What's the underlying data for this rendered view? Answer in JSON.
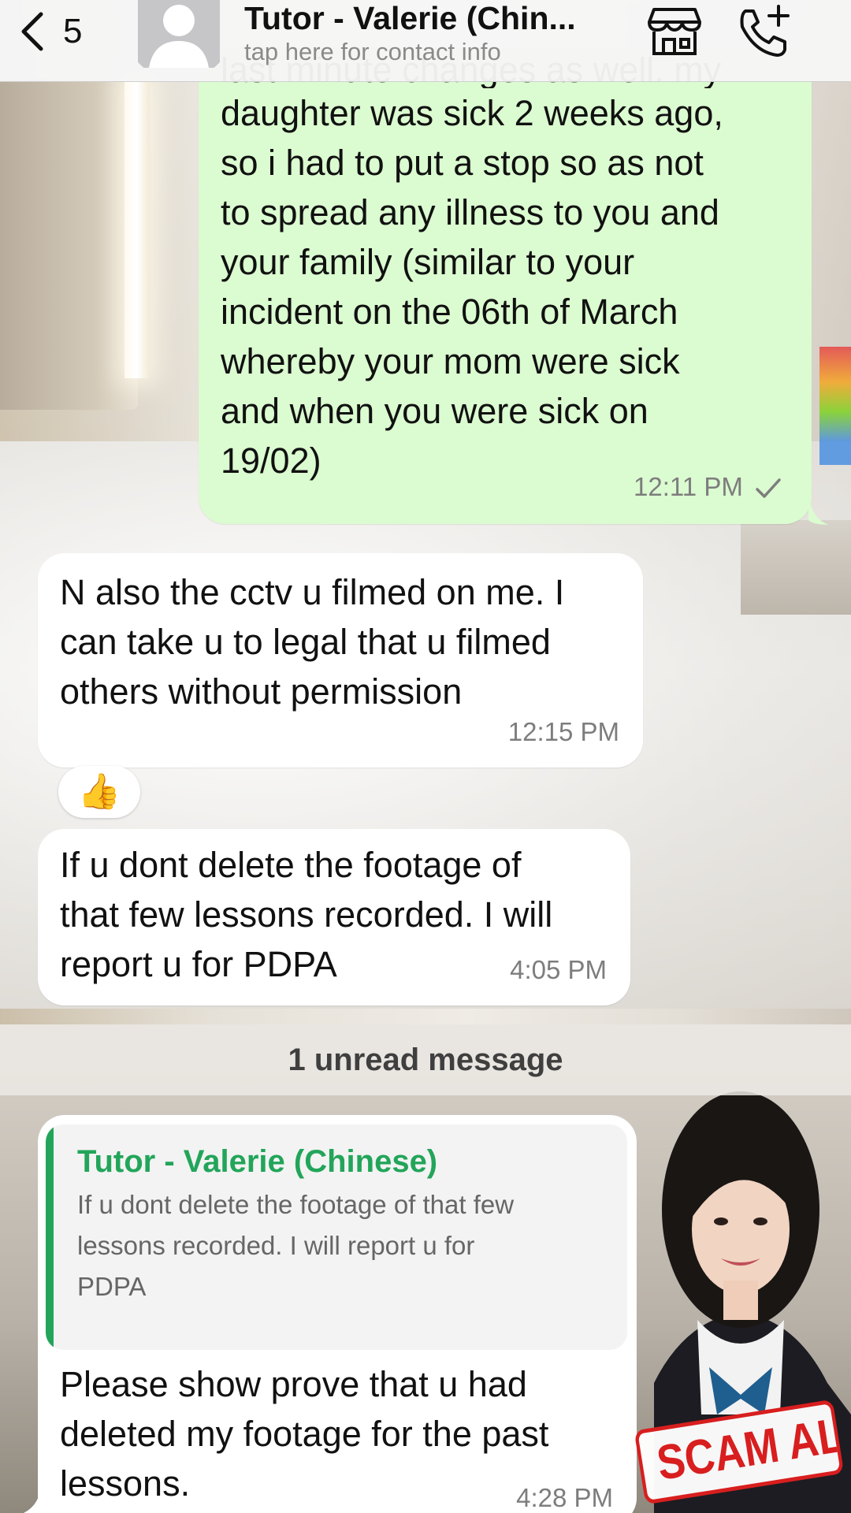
{
  "header": {
    "back_count": "5",
    "contact_name": "Tutor - Valerie (Chin...",
    "contact_subtitle": "tap here for contact info"
  },
  "messages": [
    {
      "direction": "outgoing",
      "cut_line": "last minute changes as well. my",
      "text": "daughter was sick 2 weeks ago,\nso i had to put a stop so as not\nto spread any illness to you and\nyour family (similar to your\nincident on the 06th of March\nwhereby your mom were sick\nand when you were sick on\n19/02)",
      "time": "12:11 PM",
      "status": "sent"
    },
    {
      "direction": "incoming",
      "text": "N also the cctv u filmed on me. I\ncan take u to legal that u filmed\nothers without permission",
      "time": "12:15 PM",
      "reaction": "👍"
    },
    {
      "direction": "incoming",
      "text": "If u dont delete the footage of\nthat few lessons recorded. I will\nreport u for PDPA",
      "time": "4:05 PM"
    },
    {
      "direction": "incoming",
      "quote": {
        "author": "Tutor - Valerie (Chinese)",
        "text": "If u dont delete the footage of that few\nlessons recorded. I will report u for\nPDPA"
      },
      "text": "Please show prove that u had\ndeleted my footage for the past\nlessons.",
      "time": "4:28 PM"
    }
  ],
  "unread_divider": "1 unread message",
  "stamp": "SCAM ALE",
  "colors": {
    "outgoing_bubble": "#dbfbd0",
    "incoming_bubble": "#ffffff",
    "quote_accent": "#22a55a",
    "stamp_red": "#d81e1e"
  },
  "icons": [
    "chevron-left-icon",
    "avatar-placeholder-icon",
    "business-store-icon",
    "add-call-icon",
    "check-icon"
  ]
}
